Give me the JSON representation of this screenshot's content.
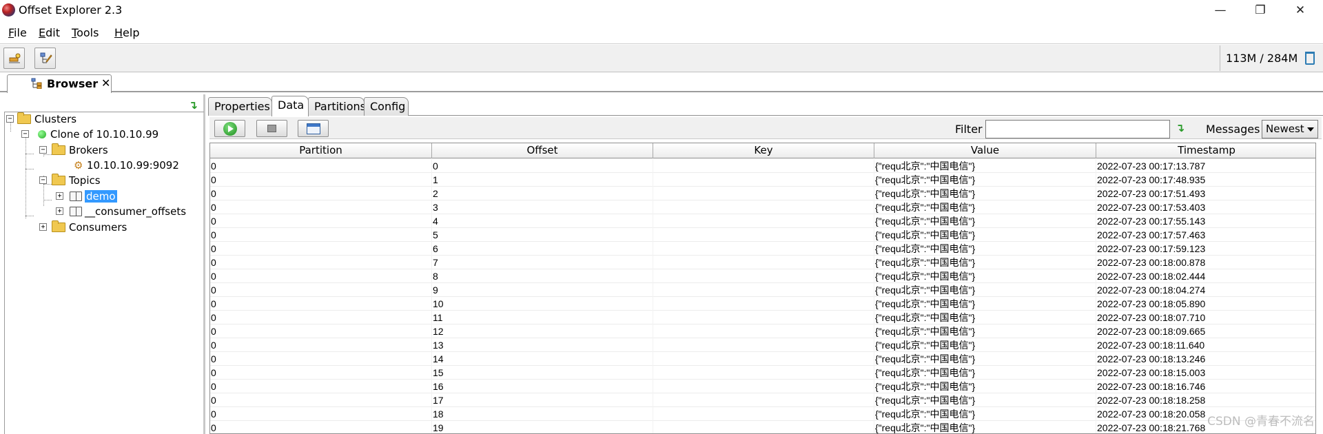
{
  "window": {
    "title": "Offset Explorer  2.3",
    "minimize_glyph": "—",
    "maximize_glyph": "❐",
    "close_glyph": "✕"
  },
  "menu": [
    {
      "accel": "F",
      "rest": "ile"
    },
    {
      "accel": "E",
      "rest": "dit"
    },
    {
      "accel": "T",
      "rest": "ools"
    },
    {
      "accel": "H",
      "rest": "elp"
    }
  ],
  "toolbar": {
    "memory": "113M / 284M",
    "icons": [
      "add-connection-icon",
      "browse-tree-icon",
      "trash-icon"
    ]
  },
  "browser_tab": {
    "label": "Browser",
    "close": "✕"
  },
  "tree": {
    "clusters": "Clusters",
    "cluster": "Clone of 10.10.10.99",
    "brokers": "Brokers",
    "broker": "10.10.10.99:9092",
    "topics": "Topics",
    "topic_selected": "demo",
    "topic_other": "__consumer_offsets",
    "consumers": "Consumers"
  },
  "sub_tabs": [
    "Properties",
    "Data",
    "Partitions",
    "Config"
  ],
  "data_toolbar": {
    "filter_label": "Filter",
    "filter_value": "",
    "messages_label": "Messages",
    "messages_selected": "Newest"
  },
  "table": {
    "columns": [
      "Partition",
      "Offset",
      "Key",
      "Value",
      "Timestamp"
    ],
    "rows": [
      [
        "0",
        "0",
        "",
        "{\"requ北京\":\"中国电信\"}",
        "2022-07-23 00:17:13.787"
      ],
      [
        "0",
        "1",
        "",
        "{\"requ北京\":\"中国电信\"}",
        "2022-07-23 00:17:48.935"
      ],
      [
        "0",
        "2",
        "",
        "{\"requ北京\":\"中国电信\"}",
        "2022-07-23 00:17:51.493"
      ],
      [
        "0",
        "3",
        "",
        "{\"requ北京\":\"中国电信\"}",
        "2022-07-23 00:17:53.403"
      ],
      [
        "0",
        "4",
        "",
        "{\"requ北京\":\"中国电信\"}",
        "2022-07-23 00:17:55.143"
      ],
      [
        "0",
        "5",
        "",
        "{\"requ北京\":\"中国电信\"}",
        "2022-07-23 00:17:57.463"
      ],
      [
        "0",
        "6",
        "",
        "{\"requ北京\":\"中国电信\"}",
        "2022-07-23 00:17:59.123"
      ],
      [
        "0",
        "7",
        "",
        "{\"requ北京\":\"中国电信\"}",
        "2022-07-23 00:18:00.878"
      ],
      [
        "0",
        "8",
        "",
        "{\"requ北京\":\"中国电信\"}",
        "2022-07-23 00:18:02.444"
      ],
      [
        "0",
        "9",
        "",
        "{\"requ北京\":\"中国电信\"}",
        "2022-07-23 00:18:04.274"
      ],
      [
        "0",
        "10",
        "",
        "{\"requ北京\":\"中国电信\"}",
        "2022-07-23 00:18:05.890"
      ],
      [
        "0",
        "11",
        "",
        "{\"requ北京\":\"中国电信\"}",
        "2022-07-23 00:18:07.710"
      ],
      [
        "0",
        "12",
        "",
        "{\"requ北京\":\"中国电信\"}",
        "2022-07-23 00:18:09.665"
      ],
      [
        "0",
        "13",
        "",
        "{\"requ北京\":\"中国电信\"}",
        "2022-07-23 00:18:11.640"
      ],
      [
        "0",
        "14",
        "",
        "{\"requ北京\":\"中国电信\"}",
        "2022-07-23 00:18:13.246"
      ],
      [
        "0",
        "15",
        "",
        "{\"requ北京\":\"中国电信\"}",
        "2022-07-23 00:18:15.003"
      ],
      [
        "0",
        "16",
        "",
        "{\"requ北京\":\"中国电信\"}",
        "2022-07-23 00:18:16.746"
      ],
      [
        "0",
        "17",
        "",
        "{\"requ北京\":\"中国电信\"}",
        "2022-07-23 00:18:18.258"
      ],
      [
        "0",
        "18",
        "",
        "{\"requ北京\":\"中国电信\"}",
        "2022-07-23 00:18:20.058"
      ],
      [
        "0",
        "19",
        "",
        "{\"requ北京\":\"中国电信\"}",
        "2022-07-23 00:18:21.768"
      ]
    ]
  },
  "watermark": "CSDN @青春不流名",
  "colors": {
    "selection": "#3399ff",
    "accent_green": "#2a9b2a",
    "trash_blue": "#2b7bb3"
  }
}
